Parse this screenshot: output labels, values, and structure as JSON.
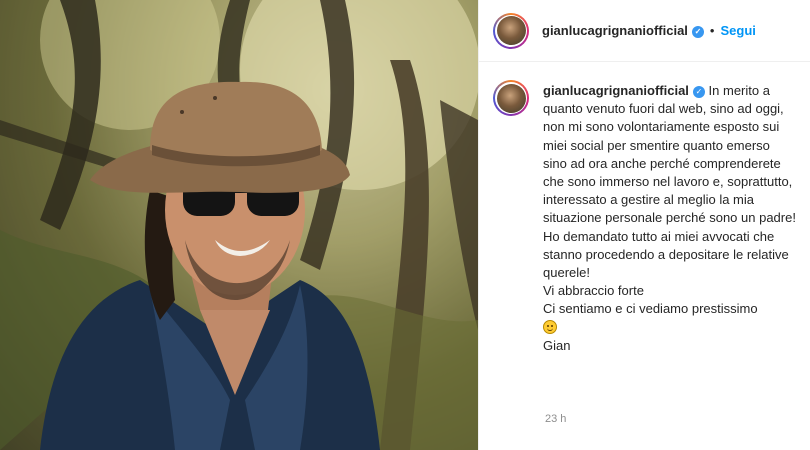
{
  "post": {
    "header": {
      "username": "gianlucagrignaniofficial",
      "separator": "•",
      "follow_label": "Segui"
    },
    "caption": {
      "username": "gianlucagrignaniofficial",
      "paragraph1": "In merito a quanto venuto fuori dal web, sino ad oggi, non mi sono volontariamente esposto sui miei social per smentire quanto emerso sino ad ora anche perché comprenderete che sono immerso nel lavoro e, soprattutto, interessato a gestire al meglio la mia situazione personale perché sono un padre!",
      "paragraph2": "Ho demandato tutto ai miei avvocati che stanno procedendo a depositare le relative querele!",
      "line3": "Vi abbraccio forte",
      "line4": "Ci sentiamo e ci vediamo prestissimo",
      "signature": "Gian"
    },
    "timestamp": "23 h"
  },
  "icons": {
    "verified": "verified-badge-icon",
    "emoji": "smiling-face-emoji"
  },
  "colors": {
    "follow": "#0095f6",
    "verified": "#3897f0",
    "text": "#262626",
    "muted": "#8e8e8e"
  }
}
